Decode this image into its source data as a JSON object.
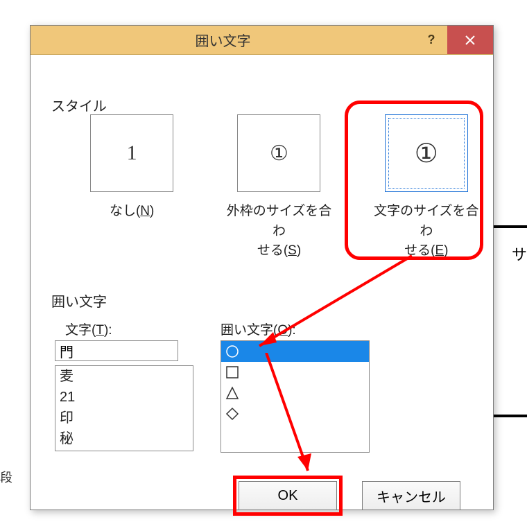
{
  "bg": {
    "left_text": "段",
    "right_text": "サ"
  },
  "titlebar": {
    "title": "囲い文字",
    "help": "?"
  },
  "sections": {
    "style": "スタイル",
    "enclose": "囲い文字"
  },
  "style_options": {
    "none": {
      "thumb": "1",
      "label_pre": "なし(",
      "accel": "N",
      "label_post": ")"
    },
    "shrink": {
      "thumb": "①",
      "label_line1": "外枠のサイズを合わ",
      "label_pre": "せる(",
      "accel": "S",
      "label_post": ")"
    },
    "enlarge": {
      "thumb": "①",
      "label_line1": "文字のサイズを合わ",
      "label_pre": "せる(",
      "accel": "E",
      "label_post": ")"
    }
  },
  "char_section": {
    "char_label_pre": "文字(",
    "char_accel": "T",
    "char_label_post": "):",
    "shape_label_pre": "囲い文字(",
    "shape_accel": "O",
    "shape_label_post": "):",
    "char_value": "門",
    "char_items": [
      "麦",
      "21",
      "印",
      "秘"
    ],
    "shape_items": [
      "circle",
      "square",
      "triangle",
      "diamond"
    ]
  },
  "buttons": {
    "ok": "OK",
    "cancel": "キャンセル"
  }
}
